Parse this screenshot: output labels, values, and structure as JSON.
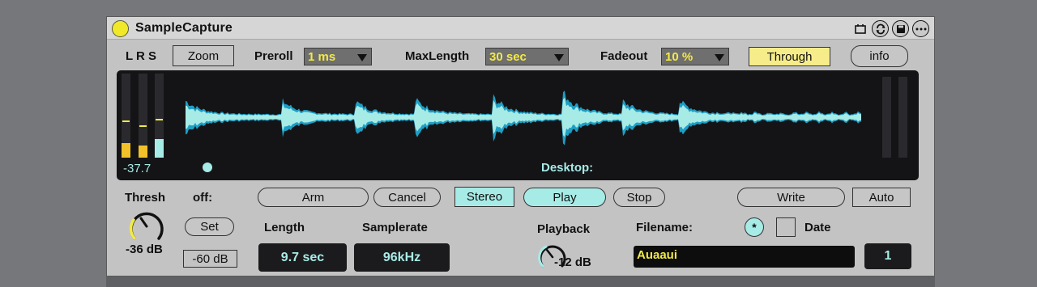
{
  "device": {
    "title": "SampleCapture",
    "title_icons": [
      "window-icon",
      "sync-icon",
      "save-icon",
      "more-icon"
    ]
  },
  "top_row": {
    "lrs_label": "L R S",
    "zoom_label": "Zoom",
    "preroll_label": "Preroll",
    "preroll_value": "1 ms",
    "maxlength_label": "MaxLength",
    "maxlength_value": "30 sec",
    "fadeout_label": "Fadeout",
    "fadeout_value": "10 %",
    "through_label": "Through",
    "info_label": "info"
  },
  "display": {
    "level_readout": "-37.7",
    "source_label": "Desktop:",
    "meter_levels": [
      0.18,
      0.15,
      0.22
    ],
    "output_meter_levels": [
      0,
      0
    ]
  },
  "bottom": {
    "thresh_label": "Thresh",
    "thresh_value": "-36 dB",
    "off_label": "off:",
    "set_label": "Set",
    "set_value": "-60 dB",
    "arm_label": "Arm",
    "cancel_label": "Cancel",
    "stereo_label": "Stereo",
    "play_label": "Play",
    "stop_label": "Stop",
    "write_label": "Write",
    "auto_label": "Auto",
    "length_label": "Length",
    "length_value": "9.7 sec",
    "samplerate_label": "Samplerate",
    "samplerate_value": "96kHz",
    "playback_label": "Playback",
    "playback_value": "-12 dB",
    "filename_label": "Filename:",
    "asterisk_label": "*",
    "date_label": "Date",
    "filename_value": "Auaaui",
    "counter_value": "1"
  },
  "colors": {
    "accent_yellow": "#f2ea45",
    "accent_cyan": "#a7ebe7",
    "waveform_dark": "#1f9ec4",
    "panel": "#c3c3c3",
    "display_bg": "#141416"
  }
}
